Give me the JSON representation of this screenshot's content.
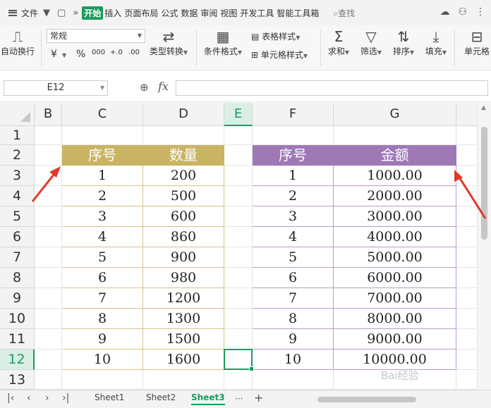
{
  "menubar": {
    "file_label": "文件",
    "tabs": [
      "开始",
      "插入",
      "页面布局",
      "公式",
      "数据",
      "审阅",
      "视图",
      "开发工具",
      "智能工具箱"
    ],
    "search_label": "查找"
  },
  "ribbon": {
    "wrap_label": "自动换行",
    "number_format": "常规",
    "currency_symbol": "¥",
    "percent_symbol": "%",
    "thousands_symbol": "000",
    "dec_inc": "+.0",
    "dec_dec": ".00",
    "type_convert_label": "类型转换",
    "cond_format_label": "条件格式",
    "table_style_label": "表格样式",
    "cell_style_label": "单元格样式",
    "sum_label": "求和",
    "filter_label": "筛选",
    "sort_label": "排序",
    "fill_label": "填充",
    "cell_label": "单元格"
  },
  "formula_bar": {
    "name_box": "E12",
    "fx_label": "fx",
    "formula": ""
  },
  "grid": {
    "columns": [
      "B",
      "C",
      "D",
      "E",
      "F",
      "G"
    ],
    "rows": [
      "1",
      "2",
      "3",
      "4",
      "5",
      "6",
      "7",
      "8",
      "9",
      "10",
      "11",
      "12",
      "13"
    ],
    "selected_cell": "E12",
    "left_table": {
      "headers": [
        "序号",
        "数量"
      ],
      "header_color": "#c9b463",
      "rows": [
        [
          "1",
          "200"
        ],
        [
          "2",
          "500"
        ],
        [
          "3",
          "600"
        ],
        [
          "4",
          "860"
        ],
        [
          "5",
          "900"
        ],
        [
          "6",
          "980"
        ],
        [
          "7",
          "1200"
        ],
        [
          "8",
          "1300"
        ],
        [
          "9",
          "1500"
        ],
        [
          "10",
          "1600"
        ]
      ]
    },
    "right_table": {
      "headers": [
        "序号",
        "金额"
      ],
      "header_color": "#9f78b6",
      "rows": [
        [
          "1",
          "1000.00"
        ],
        [
          "2",
          "2000.00"
        ],
        [
          "3",
          "3000.00"
        ],
        [
          "4",
          "4000.00"
        ],
        [
          "5",
          "5000.00"
        ],
        [
          "6",
          "6000.00"
        ],
        [
          "7",
          "7000.00"
        ],
        [
          "8",
          "8000.00"
        ],
        [
          "9",
          "9000.00"
        ],
        [
          "10",
          "10000.00"
        ]
      ]
    },
    "annotation_arrow_color": "#e0392b"
  },
  "sheet_tabs": {
    "tabs": [
      "Sheet1",
      "Sheet2",
      "Sheet3"
    ],
    "active": "Sheet3",
    "more": "···",
    "add": "+"
  },
  "accent_color": "#1c9b5f"
}
